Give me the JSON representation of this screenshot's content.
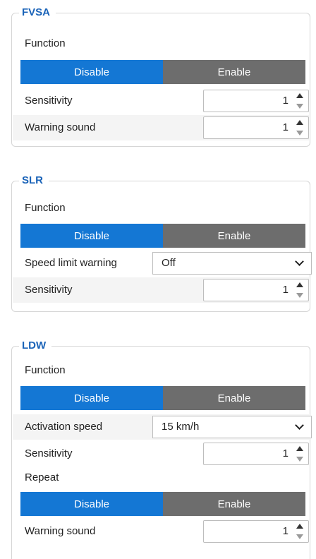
{
  "fvsa": {
    "title": "FVSA",
    "function_label": "Function",
    "toggle": {
      "disable": "Disable",
      "enable": "Enable",
      "selected": "Disable"
    },
    "sensitivity": {
      "label": "Sensitivity",
      "value": "1"
    },
    "warning_sound": {
      "label": "Warning sound",
      "value": "1"
    }
  },
  "slr": {
    "title": "SLR",
    "function_label": "Function",
    "toggle": {
      "disable": "Disable",
      "enable": "Enable",
      "selected": "Disable"
    },
    "speed_limit_warning": {
      "label": "Speed limit warning",
      "value": "Off"
    },
    "sensitivity": {
      "label": "Sensitivity",
      "value": "1"
    }
  },
  "ldw": {
    "title": "LDW",
    "function_label": "Function",
    "toggle": {
      "disable": "Disable",
      "enable": "Enable",
      "selected": "Disable"
    },
    "activation_speed": {
      "label": "Activation speed",
      "value": "15 km/h"
    },
    "sensitivity": {
      "label": "Sensitivity",
      "value": "1"
    },
    "repeat_label": "Repeat",
    "repeat_toggle": {
      "disable": "Disable",
      "enable": "Enable",
      "selected": "Disable"
    },
    "warning_sound": {
      "label": "Warning sound",
      "value": "1"
    }
  },
  "colors": {
    "accent": "#1477d4",
    "inactive": "#6d6d6d",
    "title": "#1a63b8"
  },
  "icons": [
    "chevron-down-icon",
    "spin-up-icon",
    "spin-down-icon"
  ]
}
